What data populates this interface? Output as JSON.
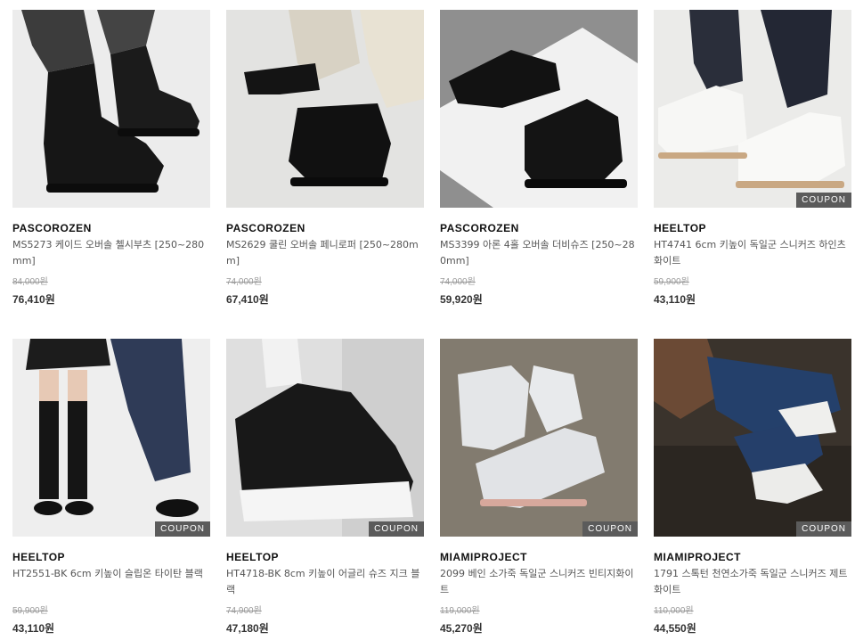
{
  "products": [
    {
      "brand": "PASCOROZEN",
      "name": "MS5273 케이드 오버솔 첼시부츠 [250~280mm]",
      "original_price": "84,000원",
      "price": "76,410원",
      "coupon": ""
    },
    {
      "brand": "PASCOROZEN",
      "name": "MS2629 쿨린 오버솔 페니로퍼 [250~280mm]",
      "original_price": "74,000원",
      "price": "67,410원",
      "coupon": ""
    },
    {
      "brand": "PASCOROZEN",
      "name": "MS3399 아론 4홀 오버솔 더비슈즈 [250~280mm]",
      "original_price": "74,000원",
      "price": "59,920원",
      "coupon": ""
    },
    {
      "brand": "HEELTOP",
      "name": "HT4741 6cm 키높이 독일군 스니커즈 하인츠 화이트",
      "original_price": "59,900원",
      "price": "43,110원",
      "coupon": "COUPON"
    },
    {
      "brand": "HEELTOP",
      "name": "HT2551-BK 6cm 키높이 슬립온 타이탄 블랙",
      "original_price": "59,900원",
      "price": "43,110원",
      "coupon": "COUPON"
    },
    {
      "brand": "HEELTOP",
      "name": "HT4718-BK 8cm 키높이 어글리 슈즈 지크 블랙",
      "original_price": "74,900원",
      "price": "47,180원",
      "coupon": "COUPON"
    },
    {
      "brand": "MIAMIPROJECT",
      "name": "2099 베인 소가죽 독일군 스니커즈 빈티지화이트",
      "original_price": "119,000원",
      "price": "45,270원",
      "coupon": "COUPON"
    },
    {
      "brand": "MIAMIPROJECT",
      "name": "1791 스톡턴 천연소가죽 독일군 스니커즈 제트화이트",
      "original_price": "110,000원",
      "price": "44,550원",
      "coupon": "COUPON"
    }
  ]
}
